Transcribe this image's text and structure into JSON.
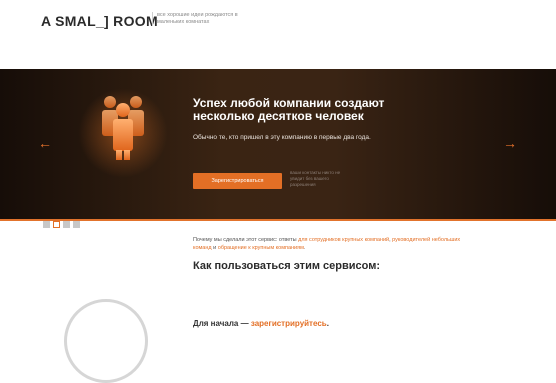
{
  "header": {
    "logo": "A SMAL_] ROOM",
    "tagline": "все хорошие идеи рождаются в маленьких комнатах"
  },
  "hero": {
    "title": "Успех любой компании создают несколько десятков человек",
    "subtitle": "Обычно те, кто пришел в эту компанию в первые два года.",
    "cta_label": "Зарегистрироваться",
    "cta_note": "ваши контакты никто не увидит без вашего разрешения",
    "prev_arrow": "←",
    "next_arrow": "→",
    "slide_count": 4,
    "active_slide": 2
  },
  "why": {
    "prefix": "Почему мы сделали этот сервис: ответы ",
    "link1": "для сотрудников крупных компаний",
    "sep1": ", ",
    "link2": "руководителей небольших команд",
    "sep2": " и ",
    "link3": "обращение к крупным компаниям",
    "suffix": "."
  },
  "how": {
    "title": "Как пользоваться этим сервисом:"
  },
  "start": {
    "prefix": "Для начала — ",
    "link": "зарегистрируйтесь",
    "suffix": "."
  },
  "colors": {
    "accent": "#e36f25",
    "hero_bg": "#2d1b0f"
  },
  "icons": {
    "hero_illustration": "people-group-icon"
  }
}
